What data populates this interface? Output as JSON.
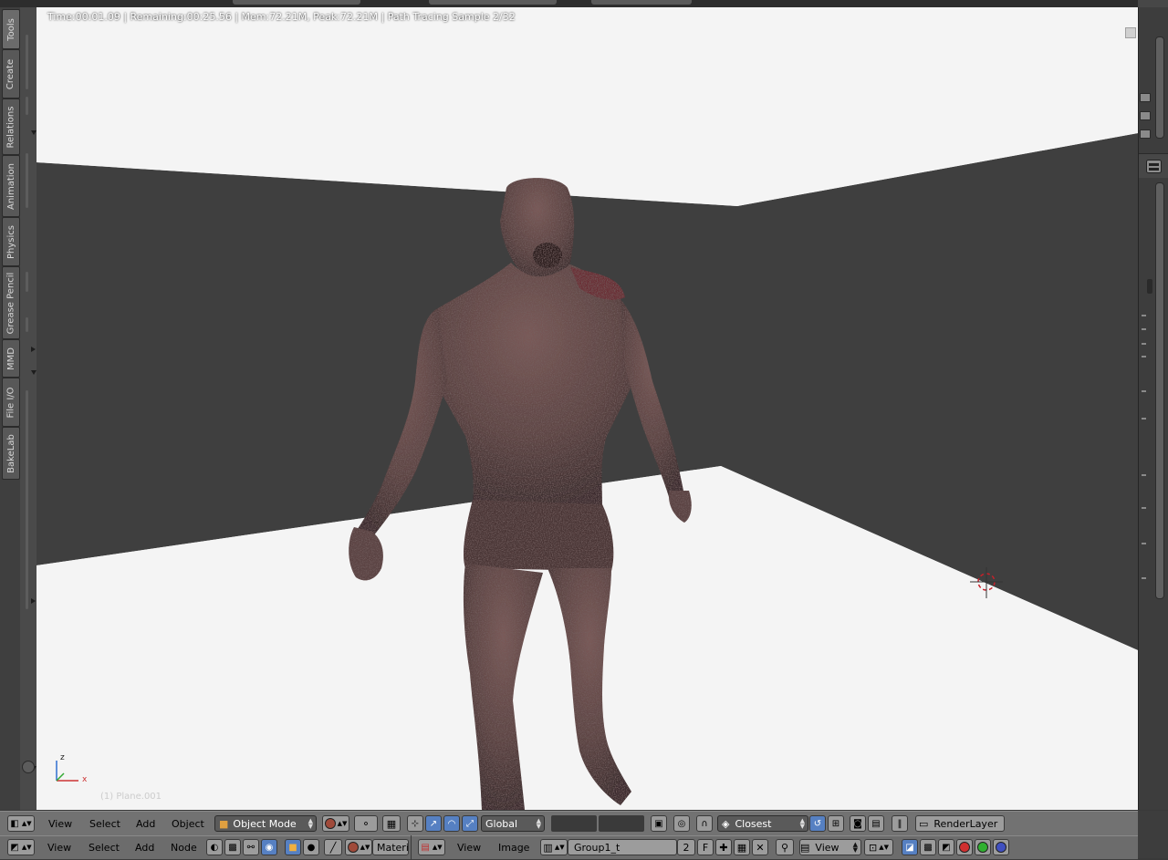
{
  "viewport": {
    "render_status": "Time:00:01.09 | Remaining:00:25.56 | Mem:72.21M, Peak:72.21M | Path Tracing Sample 2/32",
    "object_info": "(1) Plane.001",
    "axis_labels": {
      "x": "x",
      "z": "z"
    }
  },
  "tool_shelf": {
    "tabs": [
      "Tools",
      "Create",
      "Relations",
      "Animation",
      "Physics",
      "Grease Pencil",
      "MMD",
      "File I/O",
      "BakeLab"
    ]
  },
  "header_3d": {
    "menus": [
      "View",
      "Select",
      "Add",
      "Object"
    ],
    "mode": "Object Mode",
    "orientation": "Global",
    "snap_element": "Closest",
    "render_layer": "RenderLayer"
  },
  "header_node": {
    "menus": [
      "View",
      "Select",
      "Add",
      "Node"
    ],
    "material_label": "Materi"
  },
  "header_image": {
    "menus": [
      "View",
      "Image"
    ],
    "image_name": "Group1_t",
    "user_count": "2",
    "fake_user": "F",
    "view_label": "View"
  },
  "icons": {
    "editor_type": "cube-icon",
    "outliner": "outliner-icon",
    "properties": "properties-icon",
    "cursor": "3d-cursor-icon"
  },
  "colors": {
    "viewport_bg": "#f2f2f2",
    "wall": "#3f3f3f",
    "header": "#727272",
    "active_button": "#5680c2",
    "cursor_red": "#c8202a"
  }
}
